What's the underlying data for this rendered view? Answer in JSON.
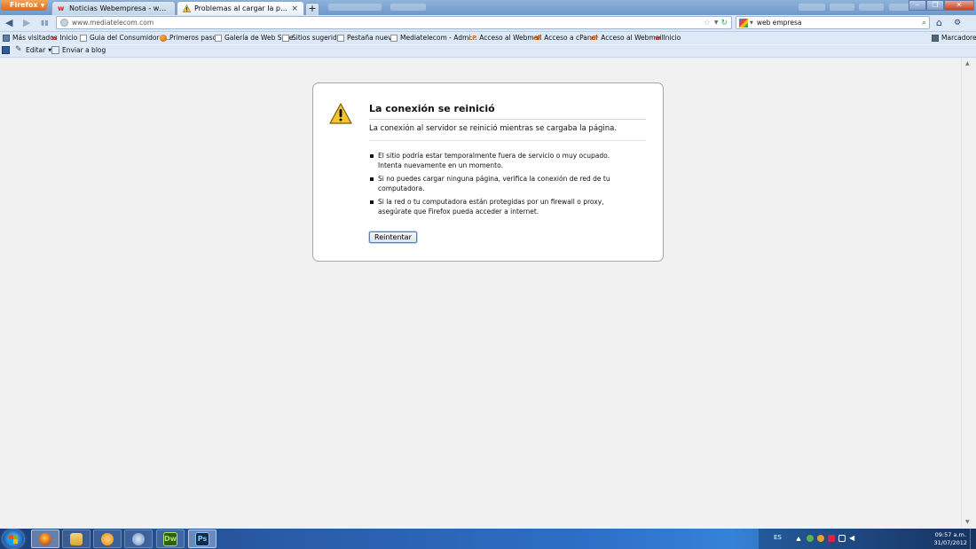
{
  "firefox_button": {
    "label": "Firefox"
  },
  "tabs": [
    {
      "label": "Noticias Webempresa - webempresa ..."
    },
    {
      "label": "Problemas al cargar la página"
    }
  ],
  "navbar": {
    "url": "www.mediatelecom.com",
    "search_query": "web empresa"
  },
  "bookmarks": [
    {
      "label": "Más visitados"
    },
    {
      "label": "Inicio"
    },
    {
      "label": "Guia del Consumidor -..."
    },
    {
      "label": "Primeros pasos"
    },
    {
      "label": "Galería de Web Slice"
    },
    {
      "label": "Sitios sugeridos"
    },
    {
      "label": "Pestaña nueva"
    },
    {
      "label": "Mediatelecom - Admi..."
    },
    {
      "label": "Acceso al Webmail"
    },
    {
      "label": "Acceso a cPanel"
    },
    {
      "label": "Acceso al Webmail"
    },
    {
      "label": "Inicio"
    }
  ],
  "bookmarks_menu": {
    "label": "Marcadores"
  },
  "addon_bar": {
    "edit_label": "Editar",
    "blog_label": "Enviar a blog"
  },
  "error": {
    "title": "La conexión se reinició",
    "description": "La conexión al servidor se reinició mientras se cargaba la página.",
    "items": [
      "El sitio podría estar temporalmente fuera de servicio o muy ocupado. Intenta nuevamente en un momento.",
      "Si no puedes cargar ninguna página, verifica la conexión de red de tu computadora.",
      "Si la red o tu computadora están protegidas por un firewall o proxy, asegúrate que Firefox pueda acceder a internet."
    ],
    "retry_label": "Reintentar"
  },
  "taskbar": {
    "apps": [
      {
        "glyph": ""
      },
      {
        "glyph": ""
      },
      {
        "glyph": ""
      },
      {
        "glyph": ""
      },
      {
        "glyph": "Dw"
      },
      {
        "glyph": "Ps"
      }
    ],
    "language": "ES",
    "time": "09:57 a.m.",
    "date": "31/07/2012"
  },
  "colors": {
    "firefox_orange": "#e2671b",
    "warning_yellow": "#f4c430",
    "taskbar_blue": "#2a5ca8"
  }
}
